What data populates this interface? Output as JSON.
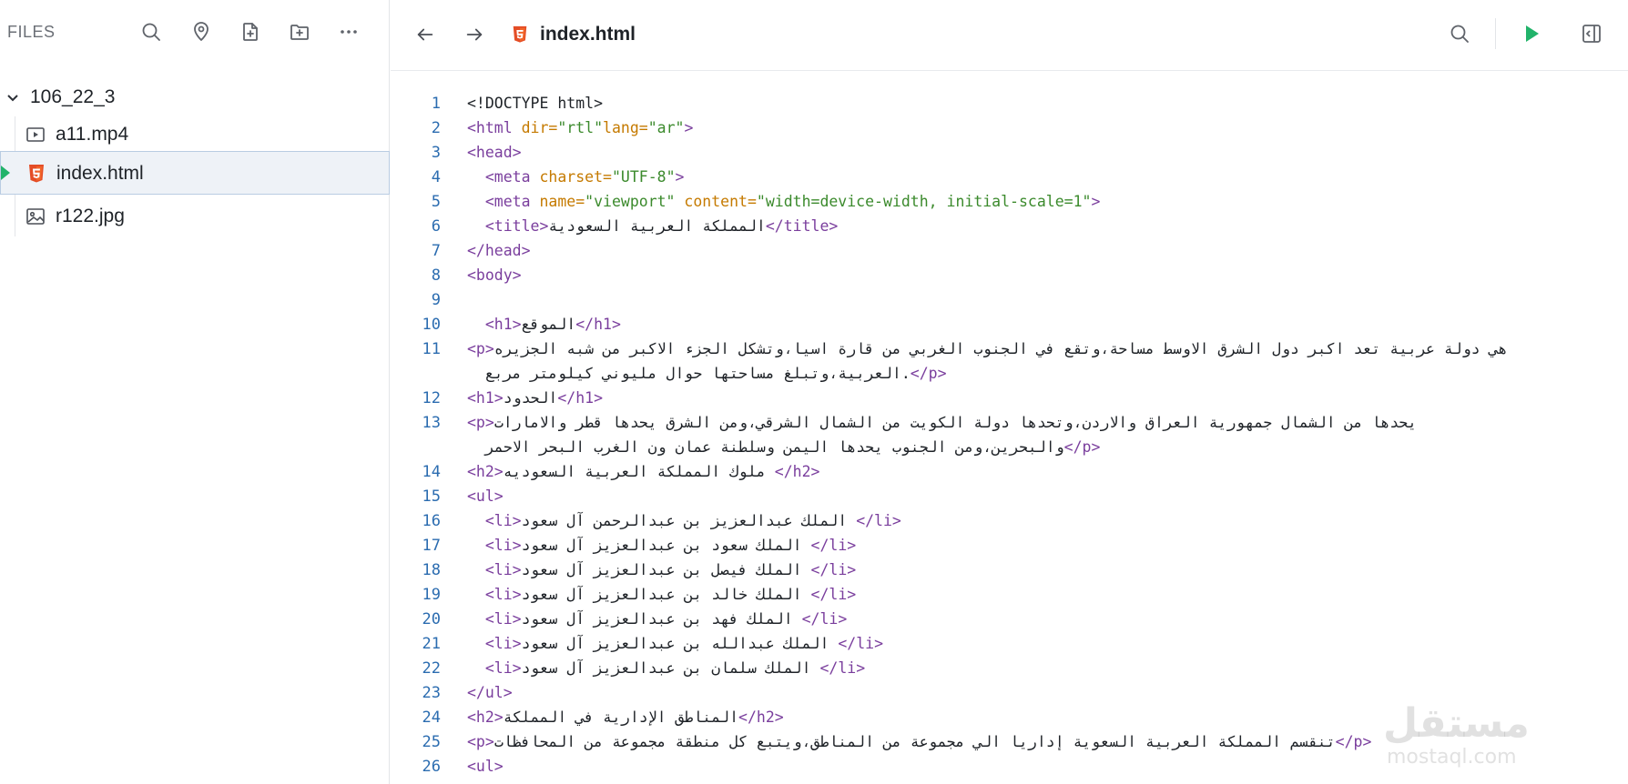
{
  "sidebar": {
    "title": "FILES",
    "toolbar_icons": [
      "search-icon",
      "location-pin-icon",
      "new-file-icon",
      "new-folder-icon",
      "more-horizontal-icon"
    ],
    "folder": {
      "name": "106_22_3",
      "expanded": true
    },
    "files": [
      {
        "name": "a11.mp4",
        "icon": "video-file-icon",
        "selected": false
      },
      {
        "name": "index.html",
        "icon": "html5-file-icon",
        "selected": true
      },
      {
        "name": "r122.jpg",
        "icon": "image-file-icon",
        "selected": false
      }
    ]
  },
  "editor": {
    "tab_name": "index.html",
    "header_icons": [
      "back-arrow-icon",
      "forward-arrow-icon",
      "search-icon",
      "run-icon",
      "split-panel-icon"
    ],
    "colors": {
      "tag": "#7a3e9d",
      "attr": "#c57a00",
      "value": "#3b8a2c",
      "line_number": "#2b6cb0",
      "run": "#21b36a",
      "html5": "#e44d26"
    },
    "lines": [
      {
        "n": "1",
        "tokens": [
          {
            "t": "txt",
            "v": "<!DOCTYPE html>"
          }
        ]
      },
      {
        "n": "2",
        "tokens": [
          {
            "t": "tag",
            "v": "<html "
          },
          {
            "t": "attr",
            "v": "dir="
          },
          {
            "t": "val",
            "v": "\"rtl\""
          },
          {
            "t": "attr",
            "v": "lang="
          },
          {
            "t": "val",
            "v": "\"ar\""
          },
          {
            "t": "tag",
            "v": ">"
          }
        ]
      },
      {
        "n": "3",
        "tokens": [
          {
            "t": "tag",
            "v": "<head>"
          }
        ]
      },
      {
        "n": "4",
        "tokens": [
          {
            "t": "txt",
            "v": "  "
          },
          {
            "t": "tag",
            "v": "<meta "
          },
          {
            "t": "attr",
            "v": "charset="
          },
          {
            "t": "val",
            "v": "\"UTF-8\""
          },
          {
            "t": "tag",
            "v": ">"
          }
        ]
      },
      {
        "n": "5",
        "tokens": [
          {
            "t": "txt",
            "v": "  "
          },
          {
            "t": "tag",
            "v": "<meta "
          },
          {
            "t": "attr",
            "v": "name="
          },
          {
            "t": "val",
            "v": "\"viewport\""
          },
          {
            "t": "attr",
            "v": " content="
          },
          {
            "t": "val",
            "v": "\"width=device-width, initial-scale=1\""
          },
          {
            "t": "tag",
            "v": ">"
          }
        ]
      },
      {
        "n": "6",
        "tokens": [
          {
            "t": "txt",
            "v": "  "
          },
          {
            "t": "tag",
            "v": "<title>"
          },
          {
            "t": "txt",
            "v": "المملكة العربية السعودية"
          },
          {
            "t": "tag",
            "v": "</title>"
          }
        ]
      },
      {
        "n": "7",
        "tokens": [
          {
            "t": "tag",
            "v": "</head>"
          }
        ]
      },
      {
        "n": "8",
        "tokens": [
          {
            "t": "tag",
            "v": "<body>"
          }
        ]
      },
      {
        "n": "9",
        "tokens": []
      },
      {
        "n": "10",
        "tokens": [
          {
            "t": "txt",
            "v": "  "
          },
          {
            "t": "tag",
            "v": "<h1>"
          },
          {
            "t": "txt",
            "v": "الموقع"
          },
          {
            "t": "tag",
            "v": "</h1>"
          }
        ]
      },
      {
        "n": "11",
        "tokens": [
          {
            "t": "tag",
            "v": "<p>"
          },
          {
            "t": "txt",
            "v": "هي دولة عربية تعد اكبر دول الشرق الاوسط مساحة،وتقع في الجنوب الغربي من قارة اسيا،وتشكل الجزء الاكبر من شبه الجزيره"
          }
        ]
      },
      {
        "n": "",
        "tokens": [
          {
            "t": "txt",
            "v": "  العربية،وتبلغ مساحتها حوال مليوني كيلومتر مربع."
          },
          {
            "t": "tag",
            "v": "</p>"
          }
        ]
      },
      {
        "n": "12",
        "tokens": [
          {
            "t": "tag",
            "v": "<h1>"
          },
          {
            "t": "txt",
            "v": "الحدود"
          },
          {
            "t": "tag",
            "v": "</h1>"
          }
        ]
      },
      {
        "n": "13",
        "tokens": [
          {
            "t": "tag",
            "v": "<p>"
          },
          {
            "t": "txt",
            "v": "يحدها من الشمال جمهورية العراق والاردن،وتحدها دولة الكويت من الشمال الشرقي،ومن الشرق يحدها قطر والامارات"
          }
        ]
      },
      {
        "n": "",
        "tokens": [
          {
            "t": "txt",
            "v": "  والبحرين،ومن الجنوب يحدها اليمن وسلطنة عمان ون الغرب البحر الاحمر"
          },
          {
            "t": "tag",
            "v": "</p>"
          }
        ]
      },
      {
        "n": "14",
        "tokens": [
          {
            "t": "tag",
            "v": "<h2>"
          },
          {
            "t": "txt",
            "v": "ملوك المملكة العربية السعوديه "
          },
          {
            "t": "tag",
            "v": "</h2>"
          }
        ]
      },
      {
        "n": "15",
        "tokens": [
          {
            "t": "tag",
            "v": "<ul>"
          }
        ]
      },
      {
        "n": "16",
        "tokens": [
          {
            "t": "txt",
            "v": "  "
          },
          {
            "t": "tag",
            "v": "<li>"
          },
          {
            "t": "txt",
            "v": "الملك عبدالعزيز بن عبدالرحمن آل سعود "
          },
          {
            "t": "tag",
            "v": "</li>"
          }
        ]
      },
      {
        "n": "17",
        "tokens": [
          {
            "t": "txt",
            "v": "  "
          },
          {
            "t": "tag",
            "v": "<li>"
          },
          {
            "t": "txt",
            "v": "الملك سعود بن عبدالعزيز آل سعود "
          },
          {
            "t": "tag",
            "v": "</li>"
          }
        ]
      },
      {
        "n": "18",
        "tokens": [
          {
            "t": "txt",
            "v": "  "
          },
          {
            "t": "tag",
            "v": "<li>"
          },
          {
            "t": "txt",
            "v": "الملك فيصل بن عبدالعزيز آل سعود "
          },
          {
            "t": "tag",
            "v": "</li>"
          }
        ]
      },
      {
        "n": "19",
        "tokens": [
          {
            "t": "txt",
            "v": "  "
          },
          {
            "t": "tag",
            "v": "<li>"
          },
          {
            "t": "txt",
            "v": "الملك خالد بن عبدالعزيز آل سعود "
          },
          {
            "t": "tag",
            "v": "</li>"
          }
        ]
      },
      {
        "n": "20",
        "tokens": [
          {
            "t": "txt",
            "v": "  "
          },
          {
            "t": "tag",
            "v": "<li>"
          },
          {
            "t": "txt",
            "v": "الملك فهد بن عبدالعزيز آل سعود "
          },
          {
            "t": "tag",
            "v": "</li>"
          }
        ]
      },
      {
        "n": "21",
        "tokens": [
          {
            "t": "txt",
            "v": "  "
          },
          {
            "t": "tag",
            "v": "<li>"
          },
          {
            "t": "txt",
            "v": "الملك عبدالله بن عبدالعزيز آل سعود "
          },
          {
            "t": "tag",
            "v": "</li>"
          }
        ]
      },
      {
        "n": "22",
        "tokens": [
          {
            "t": "txt",
            "v": "  "
          },
          {
            "t": "tag",
            "v": "<li>"
          },
          {
            "t": "txt",
            "v": "الملك سلمان بن عبدالعزيز آل سعود "
          },
          {
            "t": "tag",
            "v": "</li>"
          }
        ]
      },
      {
        "n": "23",
        "tokens": [
          {
            "t": "tag",
            "v": "</ul>"
          }
        ]
      },
      {
        "n": "24",
        "tokens": [
          {
            "t": "tag",
            "v": "<h2>"
          },
          {
            "t": "txt",
            "v": "المناطق الإدارية في المملكة"
          },
          {
            "t": "tag",
            "v": "</h2>"
          }
        ]
      },
      {
        "n": "25",
        "tokens": [
          {
            "t": "tag",
            "v": "<p>"
          },
          {
            "t": "txt",
            "v": "تنقسم المملكة العربية السعوية إداريا الي مجموعة من المناطق،ويتبع كل منطقة مجموعة من المحافظات"
          },
          {
            "t": "tag",
            "v": "</p>"
          }
        ]
      },
      {
        "n": "26",
        "tokens": [
          {
            "t": "tag",
            "v": "<ul>"
          }
        ]
      }
    ]
  },
  "watermark": {
    "text": "مستقل",
    "sub": "mostaql.com"
  }
}
